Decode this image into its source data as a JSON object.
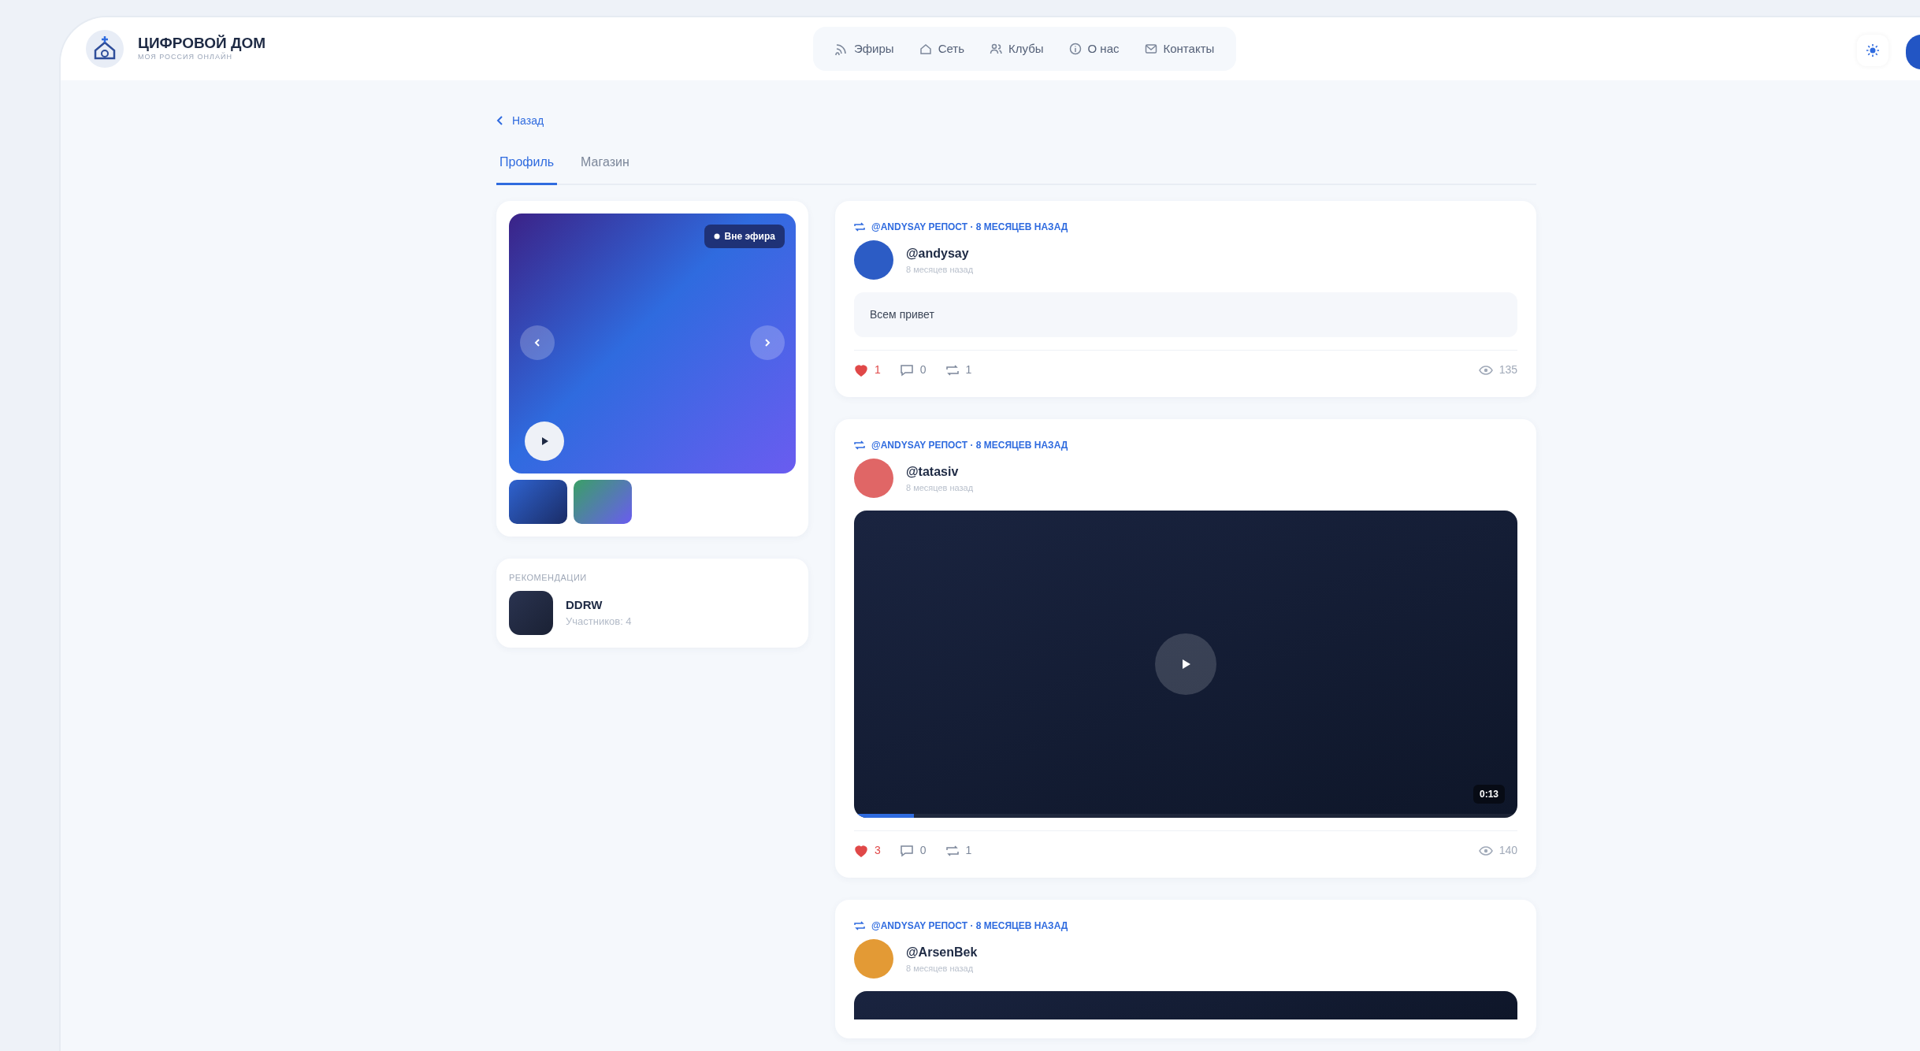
{
  "header": {
    "logo_title": "ЦИФРОВОЙ ДОМ",
    "logo_subtitle": "МОЯ РОССИЯ ОНЛАЙН",
    "nav": [
      {
        "label": "Эфиры"
      },
      {
        "label": "Сеть"
      },
      {
        "label": "Клубы"
      },
      {
        "label": "О нас"
      },
      {
        "label": "Контакты"
      }
    ]
  },
  "back_link": "Назад",
  "tabs": [
    {
      "label": "Профиль",
      "selected": true
    },
    {
      "label": "Магазин",
      "selected": false
    }
  ],
  "media_card": {
    "badge": "Вне эфира"
  },
  "recommendations": {
    "title": "РЕКОМЕНДАЦИИ",
    "items": [
      {
        "name": "DDRW",
        "subtitle": "Участников: 4"
      }
    ]
  },
  "posts": [
    {
      "repost": "@ANDYSAY РЕПОСТ · 8 МЕСЯЦЕВ НАЗАД",
      "author": "@andysay",
      "time": "8 месяцев назад",
      "color": "#2c5cc5",
      "kind": "text",
      "text": "Всем привет",
      "likes": "1",
      "liked": true,
      "comments": "0",
      "reposts": "1",
      "views": "135"
    },
    {
      "repost": "@ANDYSAY РЕПОСТ · 8 МЕСЯЦЕВ НАЗАД",
      "author": "@tatasiv",
      "time": "8 месяцев назад",
      "color": "#e06666",
      "kind": "video",
      "duration": "0:13",
      "level": 0.09,
      "likes": "3",
      "liked": true,
      "comments": "0",
      "reposts": "1",
      "views": "140"
    },
    {
      "repost": "@ANDYSAY РЕПОСТ · 8 МЕСЯЦЕВ НАЗАД",
      "author": "@ArsenBek",
      "time": "8 месяцев назад",
      "color": "#e39a35",
      "kind": "video_cut"
    }
  ]
}
